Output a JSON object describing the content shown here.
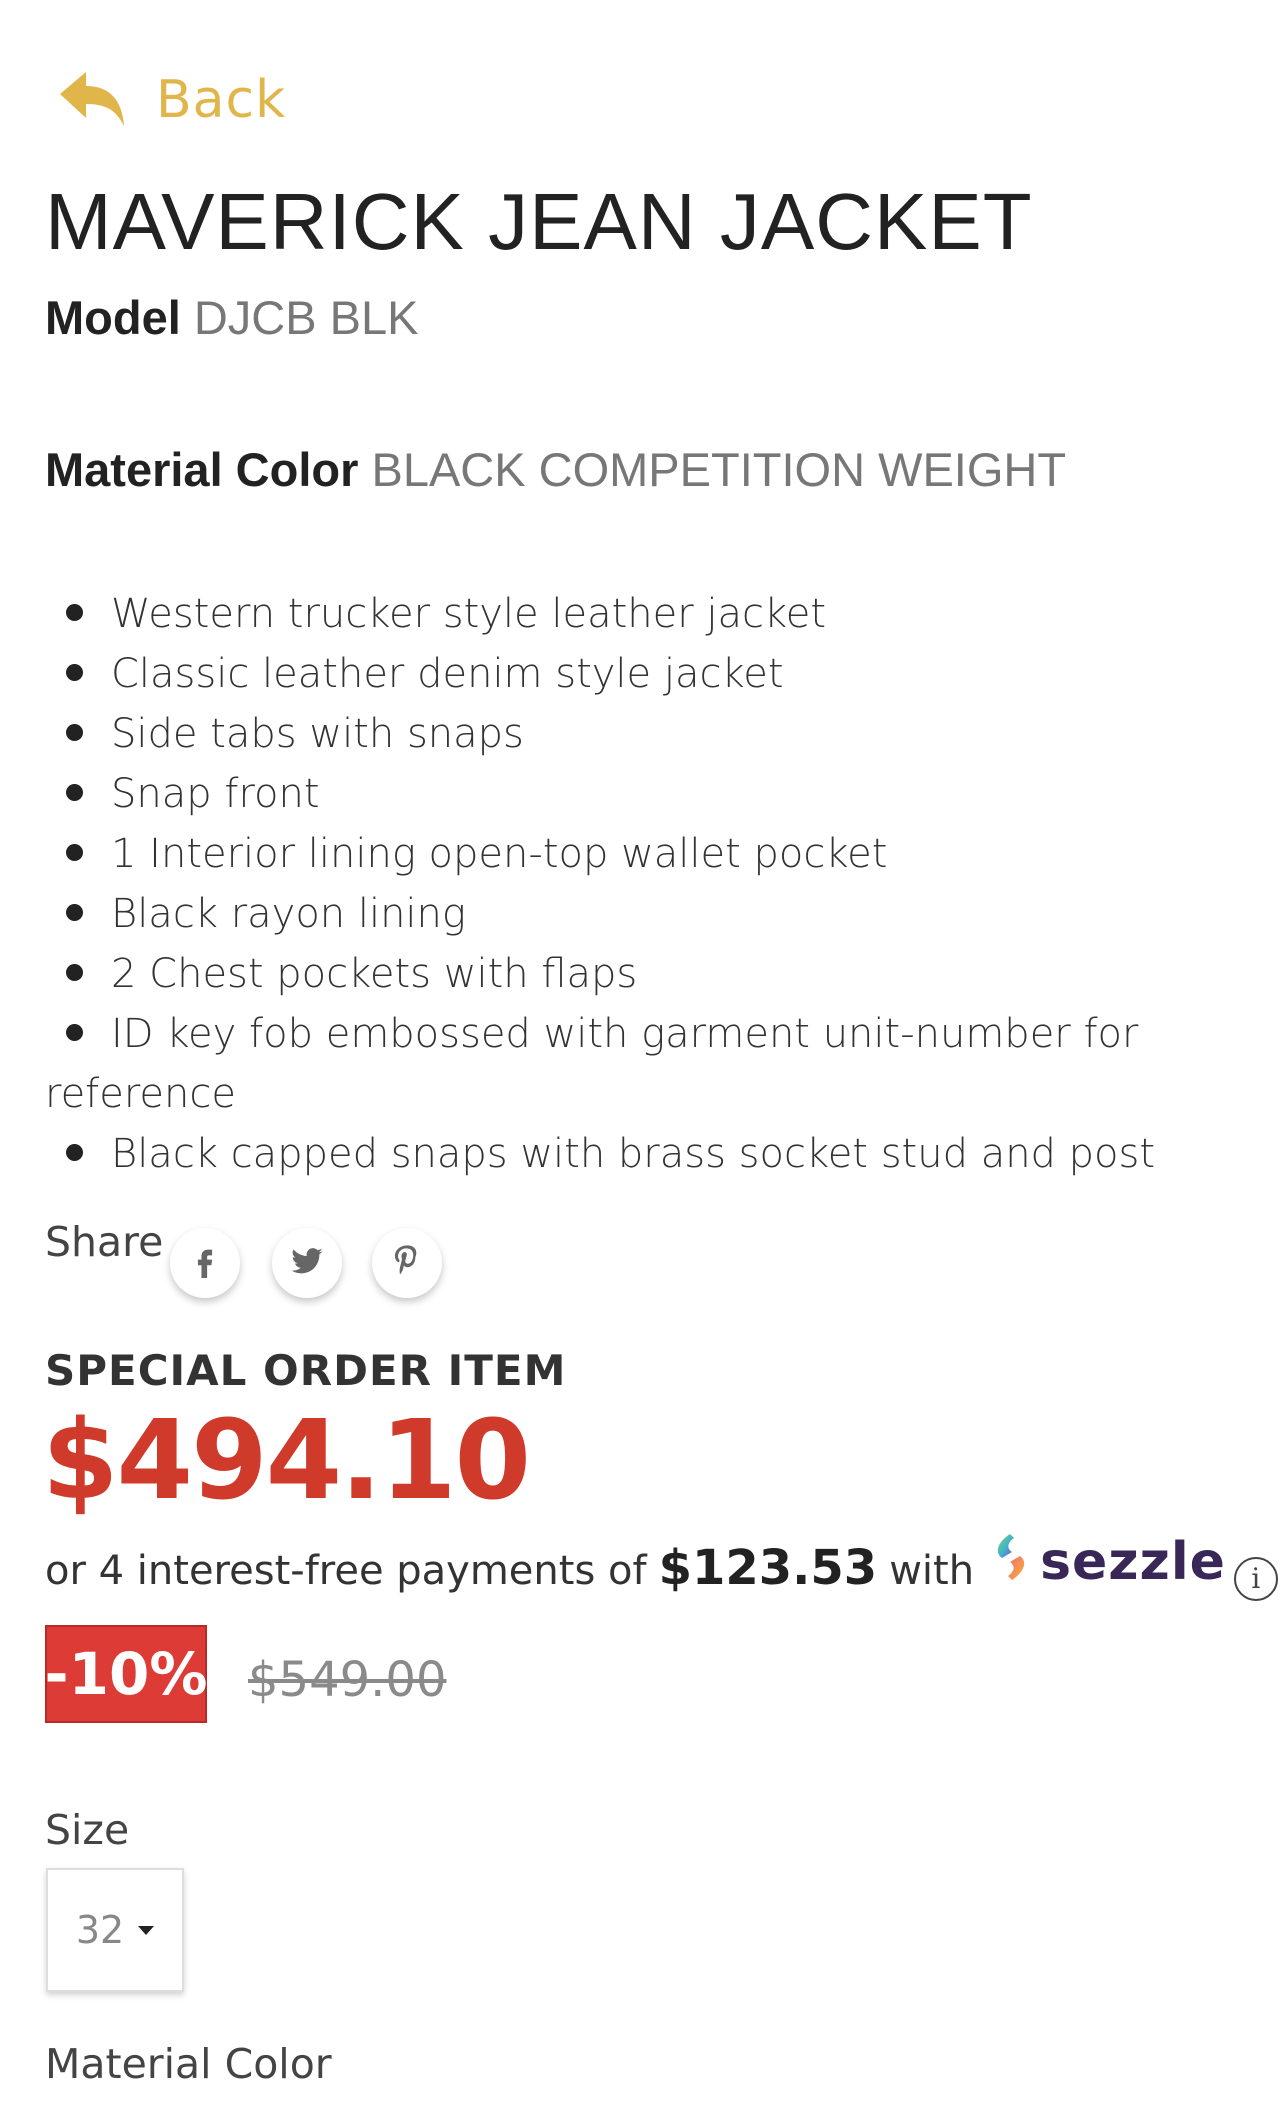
{
  "nav": {
    "back_label": "Back",
    "back_icon": "reply-arrow-icon",
    "accent_color": "#e0b54a"
  },
  "product": {
    "title": "MAVERICK JEAN JACKET",
    "model_label": "Model",
    "model_value": "DJCB BLK",
    "material_color_label": "Material Color",
    "material_color_value": "BLACK COMPETITION WEIGHT",
    "features": [
      "Western trucker style leather jacket",
      "Classic leather denim style jacket",
      "Side tabs with snaps",
      "Snap front",
      "1 Interior lining open-top wallet pocket",
      "Black rayon lining",
      "2 Chest pockets with flaps",
      "ID key fob embossed with garment unit-number for reference",
      "Black capped snaps with brass socket stud and post"
    ]
  },
  "share": {
    "label": "Share",
    "buttons": [
      {
        "name": "facebook",
        "icon": "facebook-icon"
      },
      {
        "name": "twitter",
        "icon": "twitter-icon"
      },
      {
        "name": "pinterest",
        "icon": "pinterest-icon"
      }
    ]
  },
  "pricing": {
    "special_order": "SPECIAL ORDER ITEM",
    "price": "$494.10",
    "price_color": "#cf3a2b",
    "installments_prefix": "or 4 interest-free payments of",
    "installment_amount": "$123.53",
    "installments_with": "with",
    "provider": "sezzle",
    "discount_badge": "-10%",
    "discount_color": "#dc3b36",
    "original_price": "$549.00"
  },
  "options": {
    "size_label": "Size",
    "size_value": "32",
    "material_color_label": "Material Color"
  }
}
